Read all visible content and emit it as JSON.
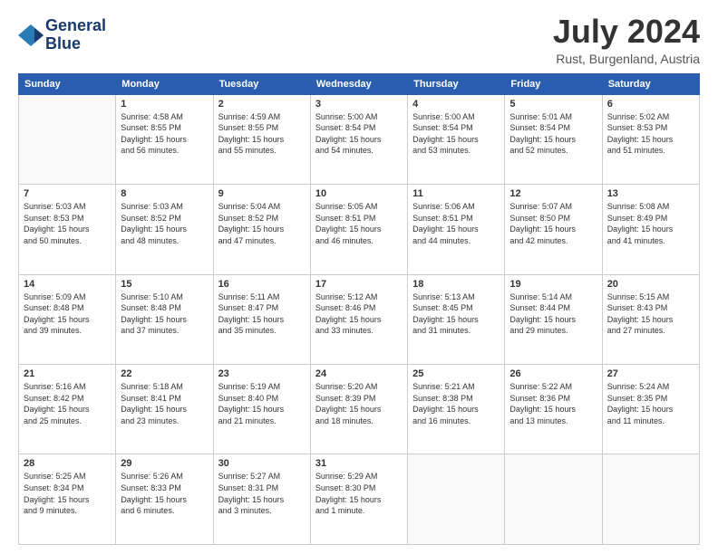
{
  "header": {
    "logo_line1": "General",
    "logo_line2": "Blue",
    "title": "July 2024",
    "location": "Rust, Burgenland, Austria"
  },
  "days_of_week": [
    "Sunday",
    "Monday",
    "Tuesday",
    "Wednesday",
    "Thursday",
    "Friday",
    "Saturday"
  ],
  "weeks": [
    [
      {
        "day": "",
        "info": ""
      },
      {
        "day": "1",
        "info": "Sunrise: 4:58 AM\nSunset: 8:55 PM\nDaylight: 15 hours\nand 56 minutes."
      },
      {
        "day": "2",
        "info": "Sunrise: 4:59 AM\nSunset: 8:55 PM\nDaylight: 15 hours\nand 55 minutes."
      },
      {
        "day": "3",
        "info": "Sunrise: 5:00 AM\nSunset: 8:54 PM\nDaylight: 15 hours\nand 54 minutes."
      },
      {
        "day": "4",
        "info": "Sunrise: 5:00 AM\nSunset: 8:54 PM\nDaylight: 15 hours\nand 53 minutes."
      },
      {
        "day": "5",
        "info": "Sunrise: 5:01 AM\nSunset: 8:54 PM\nDaylight: 15 hours\nand 52 minutes."
      },
      {
        "day": "6",
        "info": "Sunrise: 5:02 AM\nSunset: 8:53 PM\nDaylight: 15 hours\nand 51 minutes."
      }
    ],
    [
      {
        "day": "7",
        "info": "Sunrise: 5:03 AM\nSunset: 8:53 PM\nDaylight: 15 hours\nand 50 minutes."
      },
      {
        "day": "8",
        "info": "Sunrise: 5:03 AM\nSunset: 8:52 PM\nDaylight: 15 hours\nand 48 minutes."
      },
      {
        "day": "9",
        "info": "Sunrise: 5:04 AM\nSunset: 8:52 PM\nDaylight: 15 hours\nand 47 minutes."
      },
      {
        "day": "10",
        "info": "Sunrise: 5:05 AM\nSunset: 8:51 PM\nDaylight: 15 hours\nand 46 minutes."
      },
      {
        "day": "11",
        "info": "Sunrise: 5:06 AM\nSunset: 8:51 PM\nDaylight: 15 hours\nand 44 minutes."
      },
      {
        "day": "12",
        "info": "Sunrise: 5:07 AM\nSunset: 8:50 PM\nDaylight: 15 hours\nand 42 minutes."
      },
      {
        "day": "13",
        "info": "Sunrise: 5:08 AM\nSunset: 8:49 PM\nDaylight: 15 hours\nand 41 minutes."
      }
    ],
    [
      {
        "day": "14",
        "info": "Sunrise: 5:09 AM\nSunset: 8:48 PM\nDaylight: 15 hours\nand 39 minutes."
      },
      {
        "day": "15",
        "info": "Sunrise: 5:10 AM\nSunset: 8:48 PM\nDaylight: 15 hours\nand 37 minutes."
      },
      {
        "day": "16",
        "info": "Sunrise: 5:11 AM\nSunset: 8:47 PM\nDaylight: 15 hours\nand 35 minutes."
      },
      {
        "day": "17",
        "info": "Sunrise: 5:12 AM\nSunset: 8:46 PM\nDaylight: 15 hours\nand 33 minutes."
      },
      {
        "day": "18",
        "info": "Sunrise: 5:13 AM\nSunset: 8:45 PM\nDaylight: 15 hours\nand 31 minutes."
      },
      {
        "day": "19",
        "info": "Sunrise: 5:14 AM\nSunset: 8:44 PM\nDaylight: 15 hours\nand 29 minutes."
      },
      {
        "day": "20",
        "info": "Sunrise: 5:15 AM\nSunset: 8:43 PM\nDaylight: 15 hours\nand 27 minutes."
      }
    ],
    [
      {
        "day": "21",
        "info": "Sunrise: 5:16 AM\nSunset: 8:42 PM\nDaylight: 15 hours\nand 25 minutes."
      },
      {
        "day": "22",
        "info": "Sunrise: 5:18 AM\nSunset: 8:41 PM\nDaylight: 15 hours\nand 23 minutes."
      },
      {
        "day": "23",
        "info": "Sunrise: 5:19 AM\nSunset: 8:40 PM\nDaylight: 15 hours\nand 21 minutes."
      },
      {
        "day": "24",
        "info": "Sunrise: 5:20 AM\nSunset: 8:39 PM\nDaylight: 15 hours\nand 18 minutes."
      },
      {
        "day": "25",
        "info": "Sunrise: 5:21 AM\nSunset: 8:38 PM\nDaylight: 15 hours\nand 16 minutes."
      },
      {
        "day": "26",
        "info": "Sunrise: 5:22 AM\nSunset: 8:36 PM\nDaylight: 15 hours\nand 13 minutes."
      },
      {
        "day": "27",
        "info": "Sunrise: 5:24 AM\nSunset: 8:35 PM\nDaylight: 15 hours\nand 11 minutes."
      }
    ],
    [
      {
        "day": "28",
        "info": "Sunrise: 5:25 AM\nSunset: 8:34 PM\nDaylight: 15 hours\nand 9 minutes."
      },
      {
        "day": "29",
        "info": "Sunrise: 5:26 AM\nSunset: 8:33 PM\nDaylight: 15 hours\nand 6 minutes."
      },
      {
        "day": "30",
        "info": "Sunrise: 5:27 AM\nSunset: 8:31 PM\nDaylight: 15 hours\nand 3 minutes."
      },
      {
        "day": "31",
        "info": "Sunrise: 5:29 AM\nSunset: 8:30 PM\nDaylight: 15 hours\nand 1 minute."
      },
      {
        "day": "",
        "info": ""
      },
      {
        "day": "",
        "info": ""
      },
      {
        "day": "",
        "info": ""
      }
    ]
  ]
}
